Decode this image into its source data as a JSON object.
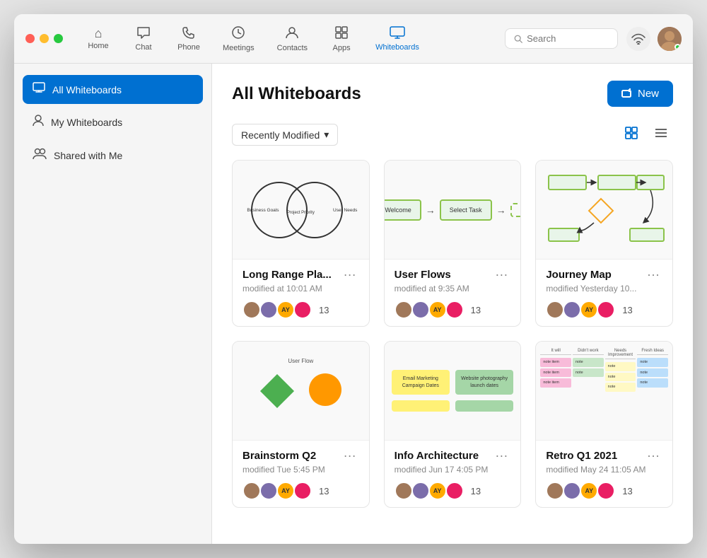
{
  "window": {
    "title": "Whiteboards"
  },
  "titlebar": {
    "nav": [
      {
        "id": "home",
        "label": "Home",
        "icon": "⌂"
      },
      {
        "id": "chat",
        "label": "Chat",
        "icon": "💬"
      },
      {
        "id": "phone",
        "label": "Phone",
        "icon": "📞"
      },
      {
        "id": "meetings",
        "label": "Meetings",
        "icon": "🕐"
      },
      {
        "id": "contacts",
        "label": "Contacts",
        "icon": "👤"
      },
      {
        "id": "apps",
        "label": "Apps",
        "icon": "⊞"
      },
      {
        "id": "whiteboards",
        "label": "Whiteboards",
        "icon": "🖥"
      }
    ],
    "search": {
      "placeholder": "Search"
    }
  },
  "sidebar": {
    "items": [
      {
        "id": "all",
        "label": "All Whiteboards",
        "icon": "▣",
        "active": true
      },
      {
        "id": "my",
        "label": "My Whiteboards",
        "icon": "👤",
        "active": false
      },
      {
        "id": "shared",
        "label": "Shared with Me",
        "icon": "👥",
        "active": false
      }
    ]
  },
  "content": {
    "title": "All Whiteboards",
    "new_button": "New",
    "filter": {
      "label": "Recently Modified",
      "chevron": "▾"
    },
    "cards": [
      {
        "id": "long-range",
        "title": "Long Range Pla...",
        "modified": "modified at 10:01 AM",
        "count": "13",
        "type": "venn"
      },
      {
        "id": "user-flows",
        "title": "User Flows",
        "modified": "modified at 9:35 AM",
        "count": "13",
        "type": "flow"
      },
      {
        "id": "journey-map",
        "title": "Journey Map",
        "modified": "modified Yesterday 10...",
        "count": "13",
        "type": "map"
      },
      {
        "id": "brainstorm",
        "title": "Brainstorm Q2",
        "modified": "modified Tue 5:45 PM",
        "count": "13",
        "type": "brain"
      },
      {
        "id": "info-arch",
        "title": "Info Architecture",
        "modified": "modified Jun 17 4:05 PM",
        "count": "13",
        "type": "info"
      },
      {
        "id": "retro",
        "title": "Retro Q1 2021",
        "modified": "modified May 24 11:05 AM",
        "count": "13",
        "type": "retro"
      }
    ]
  }
}
